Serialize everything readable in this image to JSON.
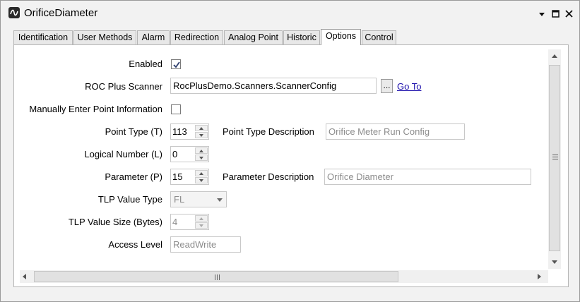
{
  "window": {
    "title": "OrificeDiameter",
    "icon": "waveform-icon"
  },
  "tabs": [
    {
      "label": "Identification"
    },
    {
      "label": "User Methods"
    },
    {
      "label": "Alarm"
    },
    {
      "label": "Redirection"
    },
    {
      "label": "Analog Point"
    },
    {
      "label": "Historic"
    },
    {
      "label": "Options"
    },
    {
      "label": "Control"
    }
  ],
  "active_tab": "Options",
  "form": {
    "enabled": {
      "label": "Enabled",
      "checked": true
    },
    "roc_plus_scanner": {
      "label": "ROC Plus Scanner",
      "value": "RocPlusDemo.Scanners.ScannerConfig",
      "browse_label": "...",
      "goto_label": "Go To"
    },
    "manual_entry": {
      "label": "Manually Enter Point Information",
      "checked": false
    },
    "point_type": {
      "label": "Point Type (T)",
      "value": "113"
    },
    "point_type_description": {
      "label": "Point Type Description",
      "value": "Orifice Meter Run Config"
    },
    "logical_number": {
      "label": "Logical Number (L)",
      "value": "0"
    },
    "parameter": {
      "label": "Parameter (P)",
      "value": "15"
    },
    "parameter_description": {
      "label": "Parameter Description",
      "value": "Orifice Diameter"
    },
    "tlp_value_type": {
      "label": "TLP Value Type",
      "value": "FL"
    },
    "tlp_value_size": {
      "label": "TLP Value Size (Bytes)",
      "value": "4"
    },
    "access_level": {
      "label": "Access Level",
      "value": "ReadWrite"
    }
  }
}
